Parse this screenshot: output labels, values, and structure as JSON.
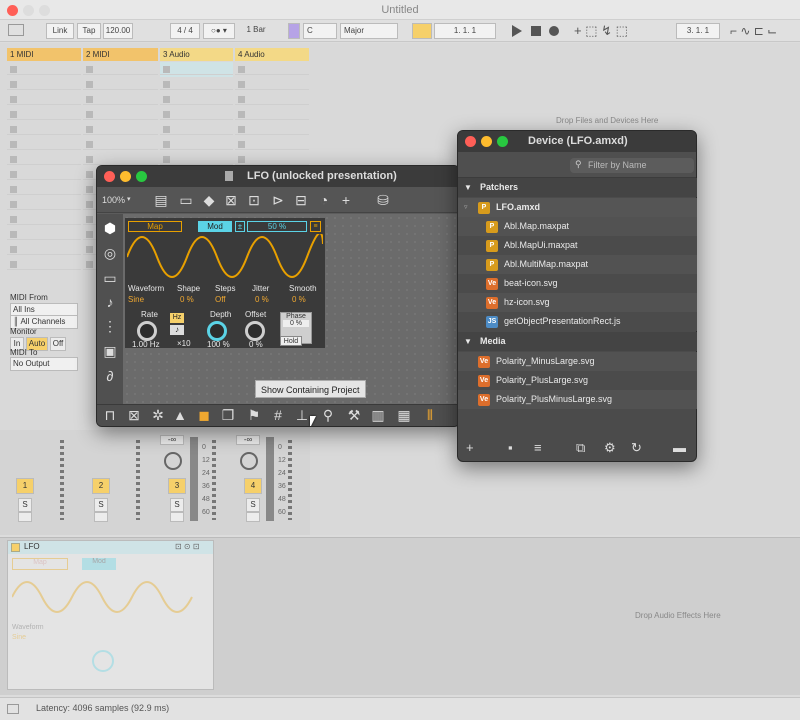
{
  "window": {
    "title": "Untitled"
  },
  "transport": {
    "link": "Link",
    "tap": "Tap",
    "tempo": "120.00",
    "sig": "4 / 4",
    "metro": "○● ▾",
    "quant": "1 Bar",
    "key": "C",
    "scale": "Major",
    "pos1": "1.   1.   1",
    "pos2": "3.   1.   1"
  },
  "tracks": [
    {
      "name": "1 MIDI",
      "color": "#f2c36b"
    },
    {
      "name": "2 MIDI",
      "color": "#f2c36b"
    },
    {
      "name": "3 Audio",
      "color": "#f3d987"
    },
    {
      "name": "4 Audio",
      "color": "#f3d987"
    }
  ],
  "io": {
    "midi_from": "MIDI From",
    "all_ins": "All Ins",
    "all_channels": "║ All Channels",
    "monitor": "Monitor",
    "in": "In",
    "auto": "Auto",
    "off": "Off",
    "midi_to": "MIDI To",
    "no_output": "No Output"
  },
  "mixer": {
    "nums": [
      "1",
      "2",
      "3",
      "4"
    ],
    "s": "S",
    "scale": [
      "0",
      "12",
      "24",
      "36",
      "48",
      "60"
    ],
    "inf": "-∞"
  },
  "drop_devices": "Drop Files and Devices Here",
  "drop_effects": "Drop Audio Effects Here",
  "status": "Latency: 4096 samples (92.9 ms)",
  "lfo_window": {
    "title": "LFO (unlocked presentation)",
    "zoom": "100%",
    "tooltip": "Show Containing Project"
  },
  "lfo": {
    "map": "Map",
    "mod": "Mod",
    "pct": "50 %",
    "waveform": "Waveform",
    "waveform_val": "Sine",
    "shape": "Shape",
    "shape_val": "0 %",
    "steps": "Steps",
    "steps_val": "Off",
    "jitter": "Jitter",
    "jitter_val": "0 %",
    "smooth": "Smooth",
    "smooth_val": "0 %",
    "rate": "Rate",
    "rate_val": "1.00 Hz",
    "hz": "Hz",
    "x10": "×10",
    "depth": "Depth",
    "depth_val": "100 %",
    "offset": "Offset",
    "offset_val": "0 %",
    "phase": "Phase",
    "phase_val": "0 %",
    "hold": "Hold"
  },
  "device_lfo_title": "LFO",
  "browser": {
    "title": "Device (LFO.amxd)",
    "filter_placeholder": "Filter by Name",
    "patchers": "Patchers",
    "root": "LFO.amxd",
    "files": [
      {
        "b": "P",
        "n": "Abl.Map.maxpat"
      },
      {
        "b": "P",
        "n": "Abl.MapUi.maxpat"
      },
      {
        "b": "P",
        "n": "Abl.MultiMap.maxpat"
      },
      {
        "b": "Ve",
        "n": "beat-icon.svg"
      },
      {
        "b": "Ve",
        "n": "hz-icon.svg"
      },
      {
        "b": "JS",
        "n": "getObjectPresentationRect.js"
      }
    ],
    "media": "Media",
    "media_files": [
      {
        "b": "Ve",
        "n": "Polarity_MinusLarge.svg"
      },
      {
        "b": "Ve",
        "n": "Polarity_PlusLarge.svg"
      },
      {
        "b": "Ve",
        "n": "Polarity_PlusMinusLarge.svg"
      }
    ]
  }
}
